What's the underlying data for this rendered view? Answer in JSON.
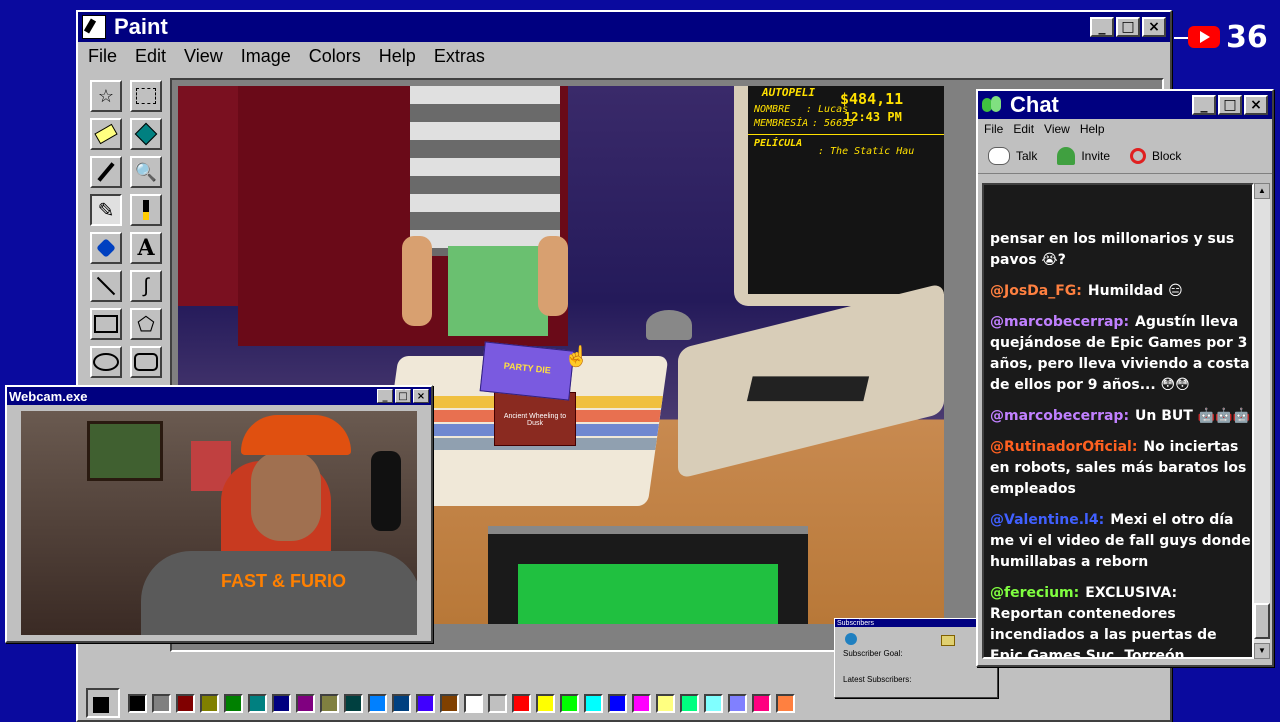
{
  "paint": {
    "title": "Paint",
    "menu": [
      "File",
      "Edit",
      "View",
      "Image",
      "Colors",
      "Help",
      "Extras"
    ],
    "tools": [
      "free-select-icon",
      "rect-select-icon",
      "eraser-icon",
      "fill-icon",
      "picker-icon",
      "magnifier-icon",
      "pencil-icon",
      "brush-icon",
      "airbrush-icon",
      "text-icon",
      "line-icon",
      "curve-icon",
      "rectangle-icon",
      "polygon-icon",
      "ellipse-icon",
      "rounded-rect-icon"
    ],
    "palette": [
      "#000000",
      "#808080",
      "#800000",
      "#808000",
      "#008000",
      "#008080",
      "#000080",
      "#800080",
      "#808040",
      "#004040",
      "#0080ff",
      "#004080",
      "#4000ff",
      "#804000",
      "#ffffff",
      "#c0c0c0",
      "#ff0000",
      "#ffff00",
      "#00ff00",
      "#00ffff",
      "#0000ff",
      "#ff00ff",
      "#ffff80",
      "#00ff80",
      "#80ffff",
      "#8080ff",
      "#ff0080",
      "#ff8040"
    ]
  },
  "screen": {
    "header": "AUTOPELI",
    "name_label": "NOMBRE",
    "name": ": Lucas",
    "member_label": "MEMBRESÍA",
    "member": ": 56653",
    "amount": "$484,11",
    "time": "12:43 PM",
    "movie_label": "PELÍCULA",
    "movie": ": The Static Hau"
  },
  "box": {
    "top": "PARTY DIE",
    "bottom": "Ancient Wheeling to Dusk"
  },
  "youtube": {
    "count": "36"
  },
  "webcam": {
    "title": "Webcam.exe",
    "shirt": "FAST & FURIO"
  },
  "subscribers": {
    "title": "Subscribers",
    "goal": "Subscriber Goal:",
    "latest": "Latest Subscribers:"
  },
  "chat": {
    "title": "Chat",
    "menu": [
      "File",
      "Edit",
      "View",
      "Help"
    ],
    "talk": "Talk",
    "invite": "Invite",
    "block": "Block",
    "messages": [
      {
        "user": "",
        "color": "#ffffff",
        "text": "pensar en los millonarios y sus pavos 😭?"
      },
      {
        "user": "@JosDa_FG:",
        "color": "#ff8040",
        "text": "Humildad 😑"
      },
      {
        "user": "@marcobecerrap:",
        "color": "#c080ff",
        "text": "Agustín lleva quejándose de Epic Games por 3 años, pero lleva viviendo a costa de ellos por 9 años... 😳😳"
      },
      {
        "user": "@marcobecerrap:",
        "color": "#c080ff",
        "text": "Un BUT 🤖🤖🤖"
      },
      {
        "user": "@RutinadorOficial:",
        "color": "#ff6020",
        "text": "No inciertas en robots, sales más baratos los empleados"
      },
      {
        "user": "@Valentine.l4:",
        "color": "#4060ff",
        "text": "Mexi el otro día me vi el video de fall guys donde humillabas a reborn"
      },
      {
        "user": "@ferecium:",
        "color": "#80ff40",
        "text": "EXCLUSIVA: Reportan contenedores incendiados a las puertas de Epic Games Suc. Torreón"
      }
    ]
  }
}
